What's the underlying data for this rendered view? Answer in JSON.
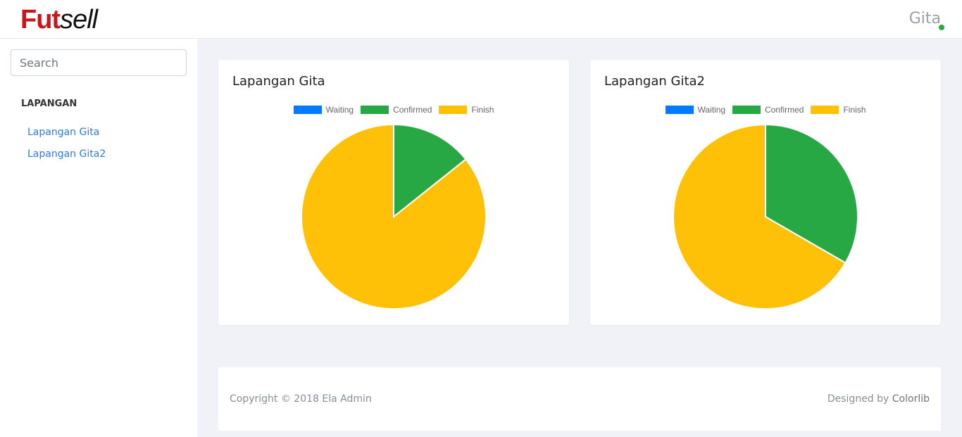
{
  "header": {
    "logo_part1": "Fut",
    "logo_part2": "sell",
    "user_name": "Gita"
  },
  "sidebar": {
    "search_placeholder": "Search",
    "section_title": "LAPANGAN",
    "items": [
      {
        "label": "Lapangan Gita"
      },
      {
        "label": "Lapangan Gita2"
      }
    ]
  },
  "colors": {
    "waiting": "#007bff",
    "confirmed": "#28a745",
    "finish": "#ffc107"
  },
  "chart_data": [
    {
      "type": "pie",
      "title": "Lapangan Gita",
      "categories": [
        "Waiting",
        "Confirmed",
        "Finish"
      ],
      "values": [
        0,
        1,
        6
      ]
    },
    {
      "type": "pie",
      "title": "Lapangan Gita2",
      "categories": [
        "Waiting",
        "Confirmed",
        "Finish"
      ],
      "values": [
        0,
        1,
        2
      ]
    }
  ],
  "footer": {
    "copyright": "Copyright © 2018 Ela Admin",
    "designed_by": "Designed by ",
    "designed_by_link": "Colorlib"
  }
}
